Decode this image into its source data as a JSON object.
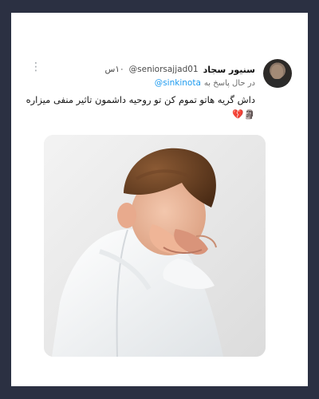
{
  "tweet": {
    "author": {
      "display_name": "سنیور سجاد",
      "handle": "@seniorsajjad01",
      "time": "۱۰س"
    },
    "reply": {
      "prefix": "در حال پاسخ به",
      "handle": "@sinkinota"
    },
    "text": "داش گریه هاتو تموم کن تو روحیه داشمون تاثیر منفی میزاره\n🗿💔",
    "more_icon": "⋮"
  },
  "colors": {
    "page_background": "#2b3042",
    "card_background": "#ffffff",
    "link": "#1d9bf0",
    "text": "#111111",
    "muted": "#4a4a4a"
  },
  "icons": {
    "more": "more-vertical-icon",
    "avatar": "avatar"
  }
}
